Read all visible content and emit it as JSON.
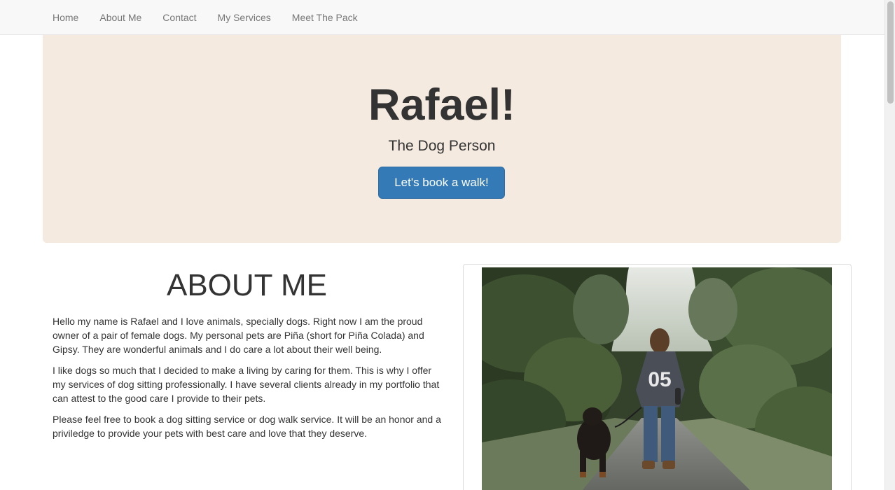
{
  "nav": {
    "items": [
      {
        "label": "Home"
      },
      {
        "label": "About Me"
      },
      {
        "label": "Contact"
      },
      {
        "label": "My Services"
      },
      {
        "label": "Meet The Pack"
      }
    ]
  },
  "hero": {
    "title": "Rafael!",
    "subtitle": "The Dog Person",
    "button_label": "Let's book a walk!",
    "background_color": "#f4eadf",
    "button_color": "#337ab7"
  },
  "about": {
    "heading": "ABOUT ME",
    "paragraphs": [
      "Hello my name is Rafael and I love animals, specially dogs. Right now I am the proud owner of a pair of female dogs. My personal pets are Piña (short for Piña Colada) and Gipsy. They are wonderful animals and I do care a lot about their well being.",
      "I like dogs so much that I decided to make a living by caring for them. This is why I offer my services of dog sitting professionally. I have several clients already in my portfolio that can attest to the good care I provide to their pets.",
      "Please feel free to book a dog sitting service or dog walk service. It will be an honor and a priviledge to provide your pets with best care and love that they deserve."
    ]
  },
  "photo": {
    "sweatshirt_text": "05"
  }
}
